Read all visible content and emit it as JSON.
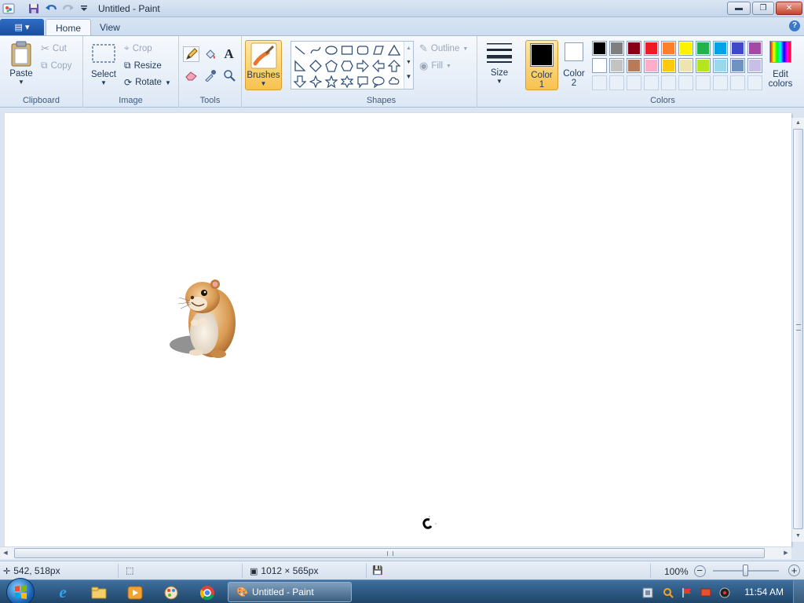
{
  "window": {
    "title": "Untitled - Paint"
  },
  "tabs": [
    {
      "label": "Home",
      "active": true
    },
    {
      "label": "View",
      "active": false
    }
  ],
  "ribbon": {
    "clipboard": {
      "group_label": "Clipboard",
      "paste": "Paste",
      "cut": "Cut",
      "copy": "Copy"
    },
    "image": {
      "group_label": "Image",
      "select": "Select",
      "crop": "Crop",
      "resize": "Resize",
      "rotate": "Rotate"
    },
    "tools": {
      "group_label": "Tools"
    },
    "brushes": {
      "label": "Brushes"
    },
    "shapes": {
      "group_label": "Shapes",
      "outline": "Outline",
      "fill": "Fill"
    },
    "size": {
      "label": "Size"
    },
    "colors": {
      "group_label": "Colors",
      "color1_line1": "Color",
      "color1_line2": "1",
      "color2_line1": "Color",
      "color2_line2": "2",
      "color1_value": "#000000",
      "color2_value": "#ffffff",
      "edit_line1": "Edit",
      "edit_line2": "colors",
      "palette_row1": [
        "#000000",
        "#7f7f7f",
        "#880015",
        "#ed1c24",
        "#ff7f27",
        "#fff200",
        "#22b14c",
        "#00a2e8",
        "#3f48cc",
        "#a349a4"
      ],
      "palette_row2": [
        "#ffffff",
        "#c3c3c3",
        "#b97a57",
        "#ffaec9",
        "#ffc90e",
        "#efe4b0",
        "#b5e61d",
        "#99d9ea",
        "#7092be",
        "#c8bfe7"
      ],
      "palette_row3_empty": 10
    }
  },
  "status": {
    "cursor_pos": "542, 518px",
    "canvas_size": "1012 × 565px",
    "zoom": "100%"
  },
  "taskbar": {
    "task_label": "Untitled - Paint",
    "clock": "11:54 AM"
  }
}
